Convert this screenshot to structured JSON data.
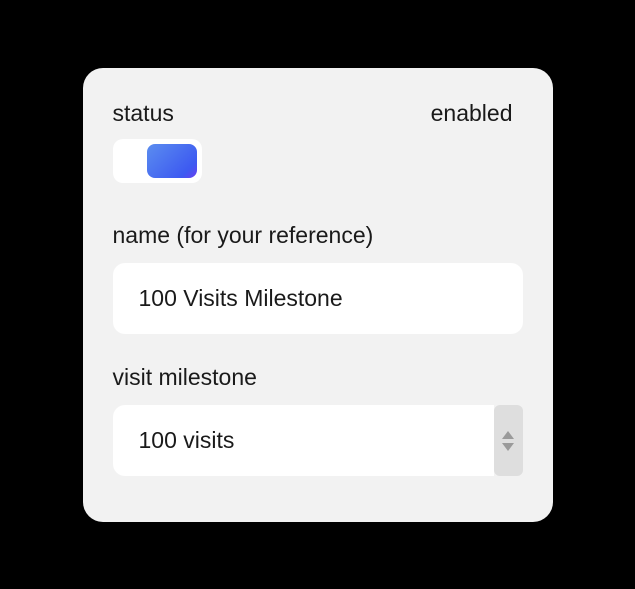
{
  "status": {
    "label": "status",
    "state_label": "enabled",
    "enabled": true
  },
  "name": {
    "label": "name (for your reference)",
    "value": "100 Visits Milestone"
  },
  "milestone": {
    "label": "visit milestone",
    "value": "100 visits"
  }
}
